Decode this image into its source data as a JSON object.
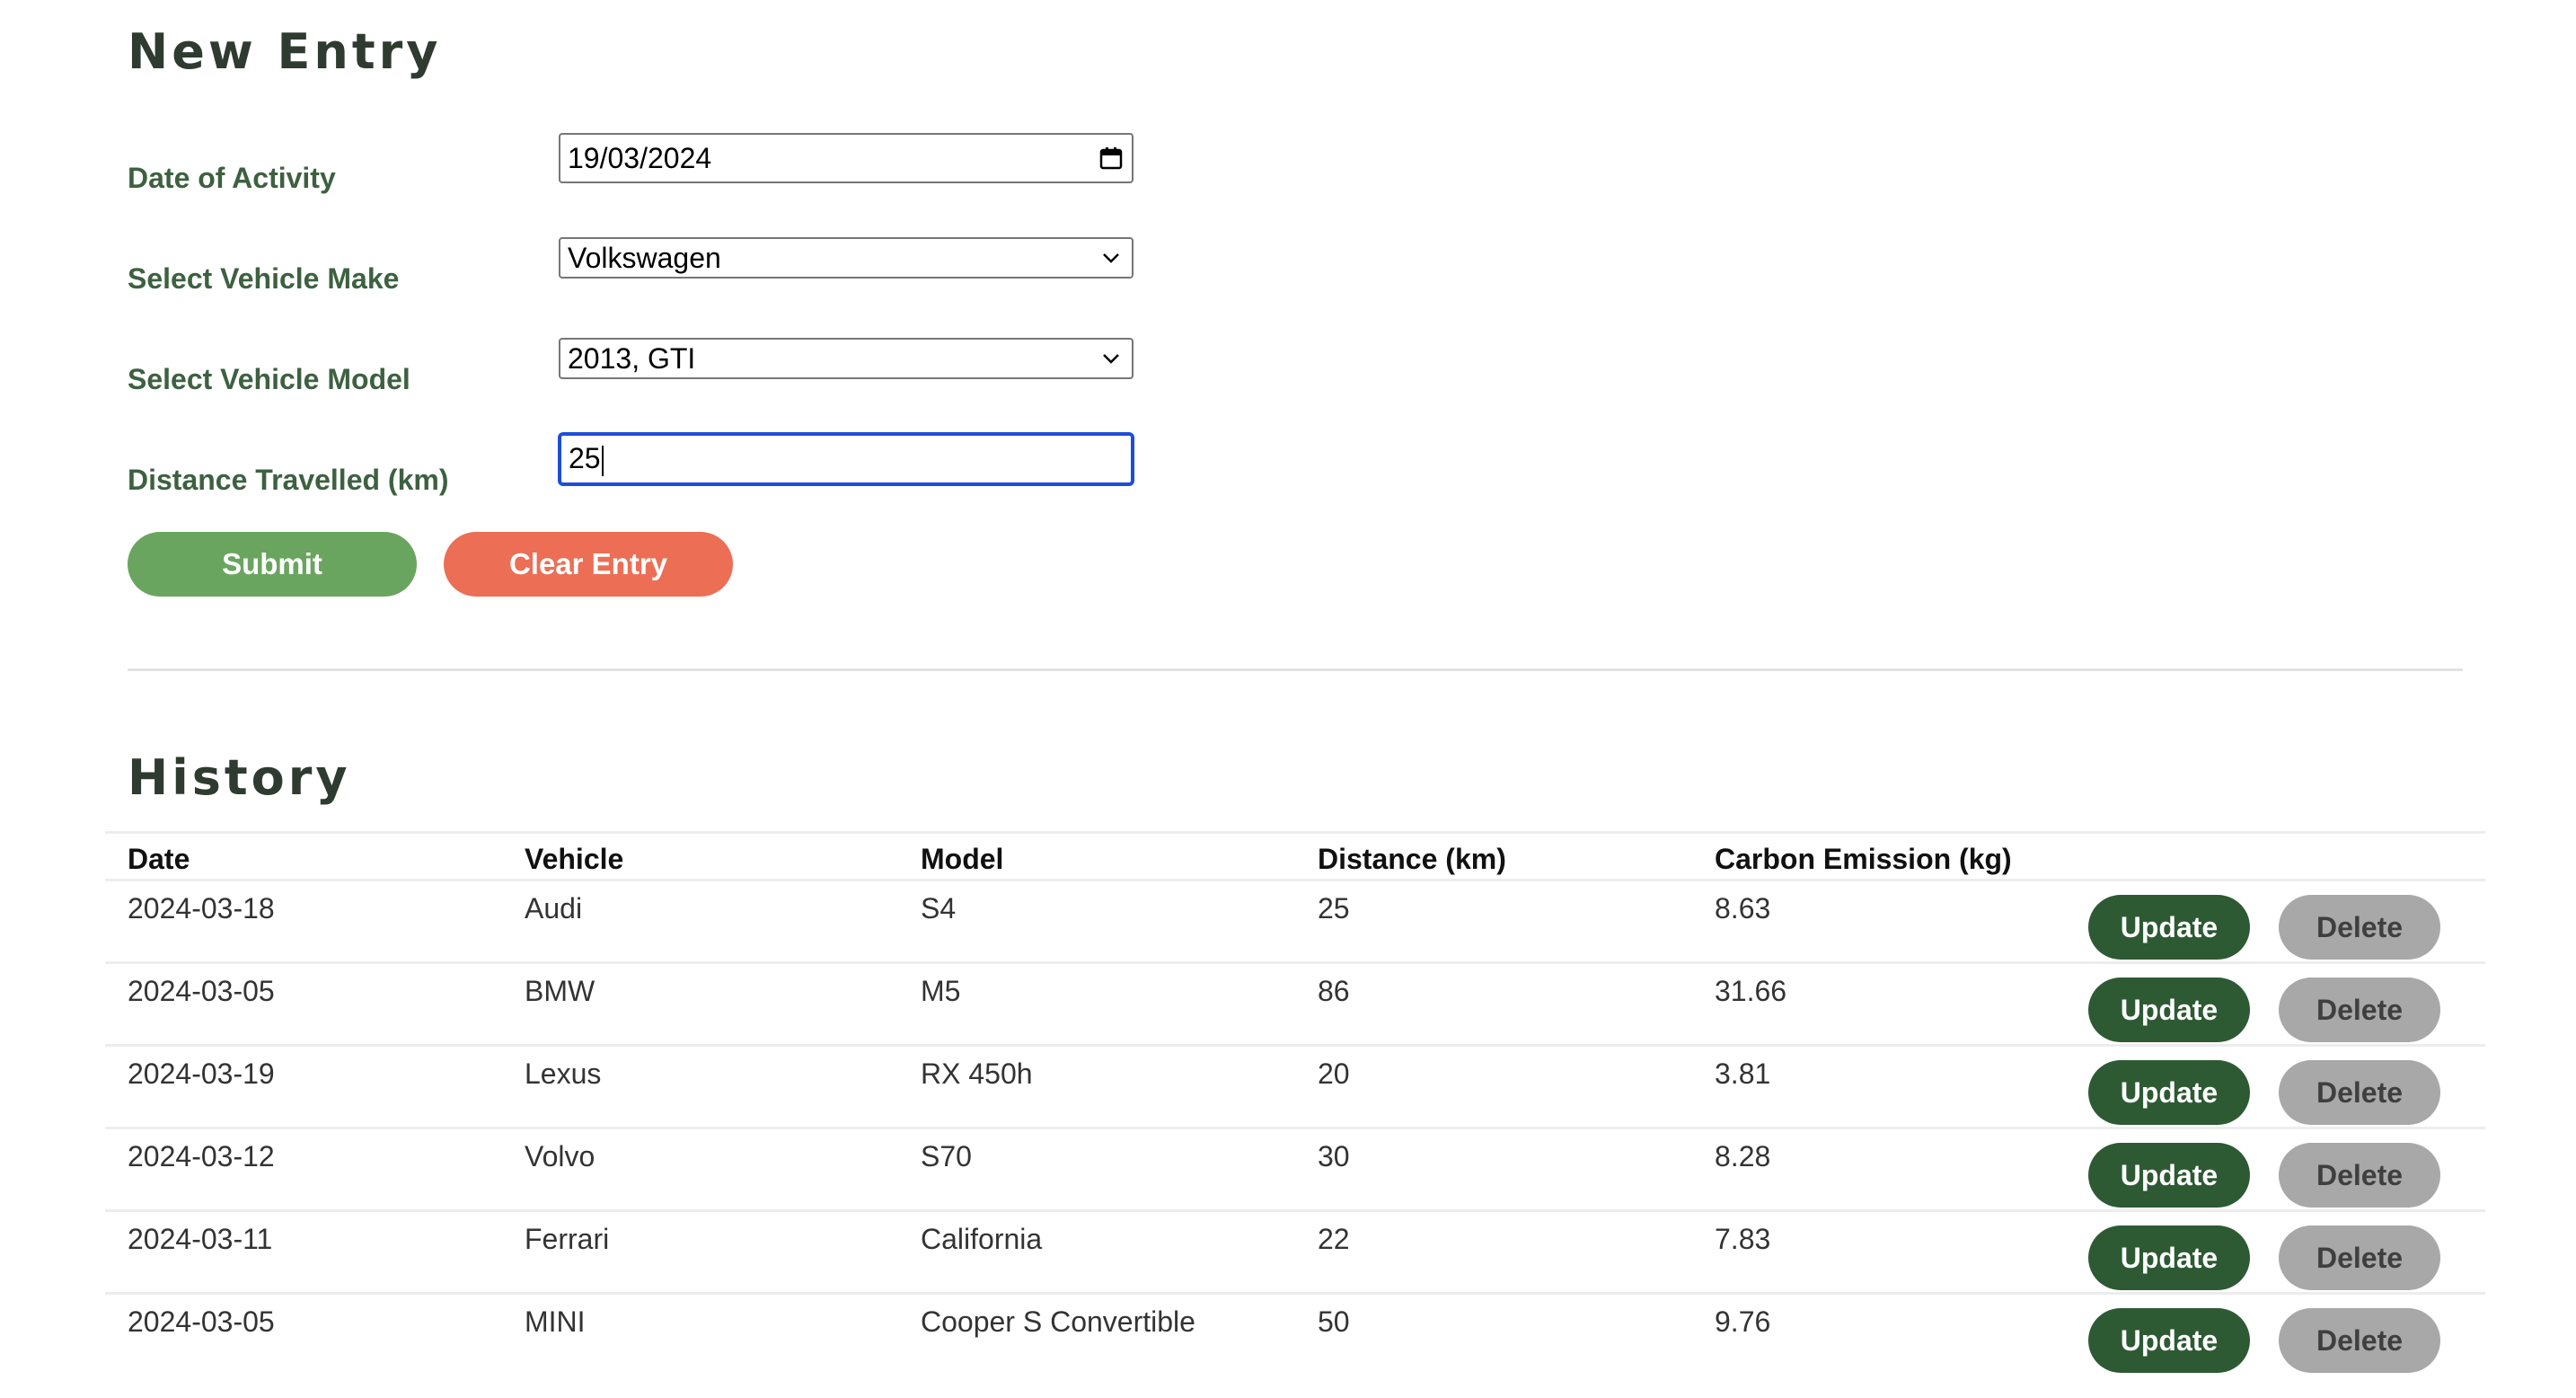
{
  "new_entry": {
    "title": "New Entry",
    "date_label": "Date of Activity",
    "date_value": "19/03/2024",
    "make_label": "Select Vehicle Make",
    "make_value": "Volkswagen",
    "model_label": "Select Vehicle Model",
    "model_value": "2013, GTI",
    "distance_label": "Distance Travelled (km)",
    "distance_value": "25",
    "submit_label": "Submit",
    "clear_label": "Clear Entry"
  },
  "history": {
    "title": "History",
    "columns": [
      "Date",
      "Vehicle",
      "Model",
      "Distance (km)",
      "Carbon Emission (kg)"
    ],
    "update_label": "Update",
    "delete_label": "Delete",
    "rows": [
      {
        "date": "2024-03-18",
        "vehicle": "Audi",
        "model": "S4",
        "distance": "25",
        "emission": "8.63"
      },
      {
        "date": "2024-03-05",
        "vehicle": "BMW",
        "model": "M5",
        "distance": "86",
        "emission": "31.66"
      },
      {
        "date": "2024-03-19",
        "vehicle": "Lexus",
        "model": "RX 450h",
        "distance": "20",
        "emission": "3.81"
      },
      {
        "date": "2024-03-12",
        "vehicle": "Volvo",
        "model": "S70",
        "distance": "30",
        "emission": "8.28"
      },
      {
        "date": "2024-03-11",
        "vehicle": "Ferrari",
        "model": "California",
        "distance": "22",
        "emission": "7.83"
      },
      {
        "date": "2024-03-05",
        "vehicle": "MINI",
        "model": "Cooper S Convertible",
        "distance": "50",
        "emission": "9.76"
      }
    ]
  },
  "colors": {
    "heading": "#2f3b30",
    "label": "#3d6140",
    "submit": "#6aa55f",
    "clear": "#ec6e55",
    "update": "#2d5a33",
    "delete": "#a8a8a8",
    "focus_ring": "#1d4ed8"
  },
  "icons": {
    "date_picker": "calendar-icon",
    "dropdown": "chevron-down-icon"
  }
}
